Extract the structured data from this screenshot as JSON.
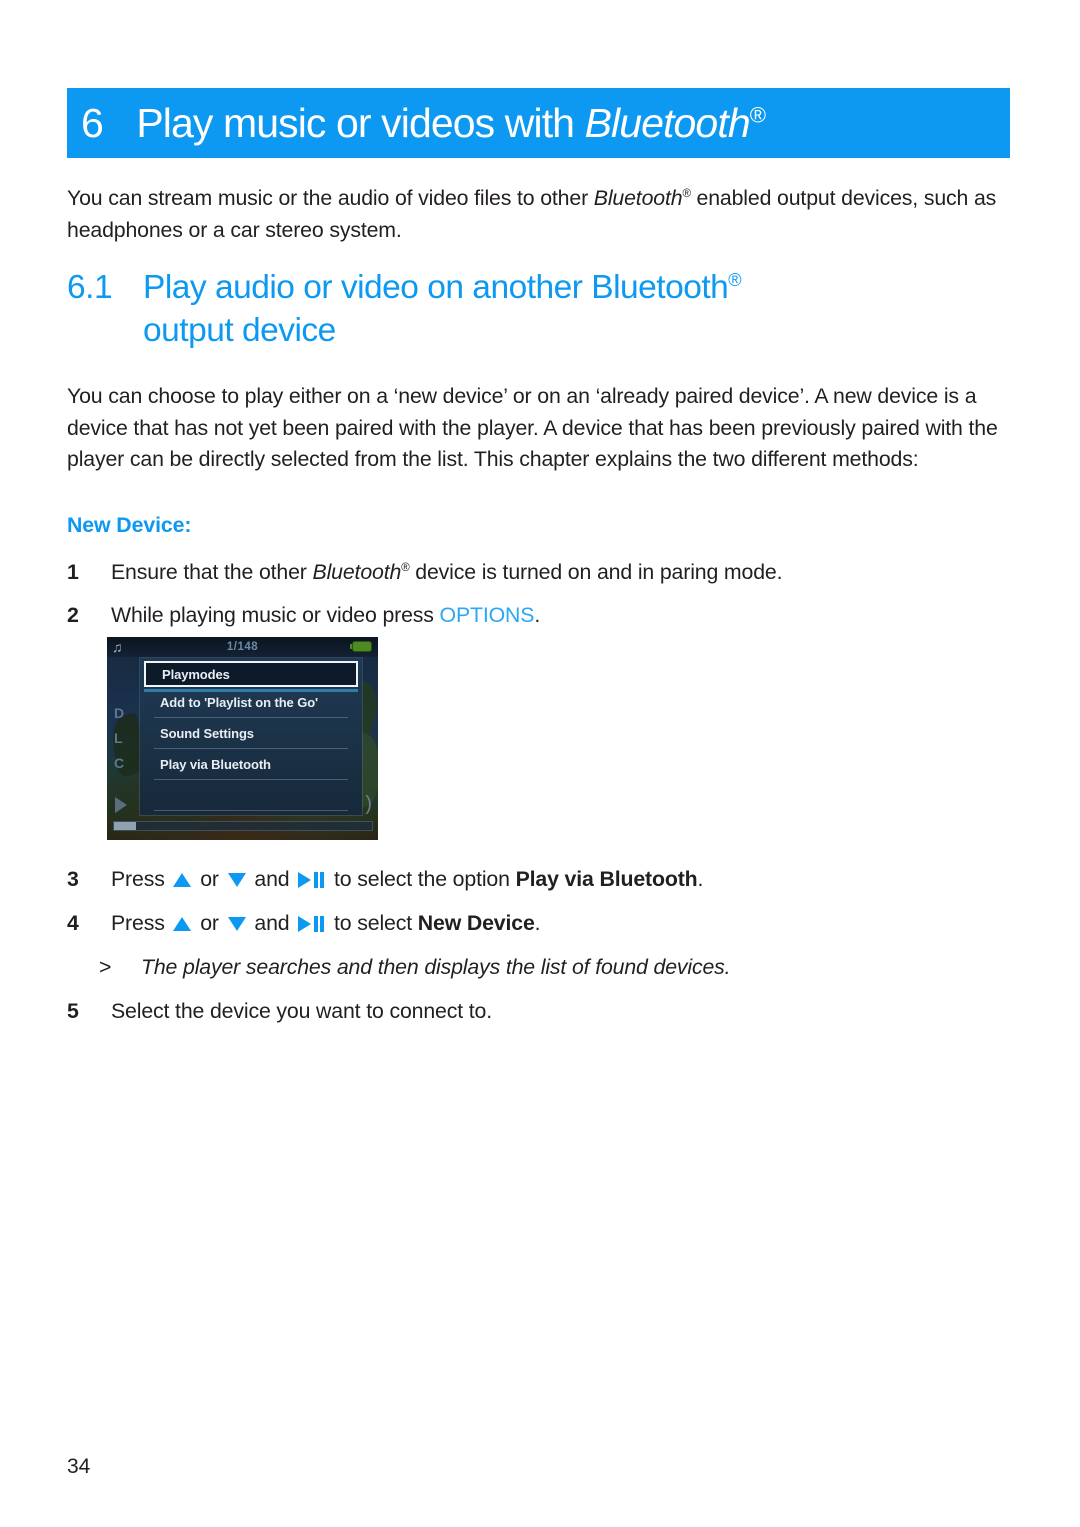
{
  "colors": {
    "brand_blue": "#0d99f2",
    "link_blue": "#2aa7f5",
    "body_text": "#231f20"
  },
  "chapter": {
    "number": "6",
    "title_plain": "Play music or videos with ",
    "title_italic": "Bluetooth",
    "registered_mark": "®"
  },
  "intro": {
    "part1": "You can stream music or the audio of video files to other ",
    "italic": "Bluetooth",
    "sup": "®",
    "part2": " enabled output devices, such as headphones or a car stereo system."
  },
  "section": {
    "number": "6.1",
    "title_part1": "Play audio or video on another Bluetooth",
    "sup": "®",
    "title_part2": "output device"
  },
  "methods_para": "You can choose to play either on a ‘new device’ or on an ‘already paired device’. A new device is a device that has not yet been paired with the player. A device that has been previously paired with the player can be directly selected from the list. This chapter explains the two different methods:",
  "subheading": "New Device:",
  "steps": [
    {
      "num": "1",
      "pre": "Ensure that the other ",
      "italic": "Bluetooth",
      "sup": "®",
      "post": " device is turned on and in paring mode."
    },
    {
      "num": "2",
      "pre": "While playing music or video press ",
      "keyword": "OPTIONS",
      "post": "."
    },
    {
      "num": "3",
      "pre": "Press ",
      "mid1": " or ",
      "mid2": " and ",
      "mid3": " to select the option ",
      "bold": "Play via Bluetooth",
      "post": "."
    },
    {
      "num": "4",
      "pre": "Press ",
      "mid1": " or ",
      "mid2": " and ",
      "mid3": " to select ",
      "bold": "New Device",
      "post": "."
    }
  ],
  "note": {
    "marker": ">",
    "text": "The player searches and then displays the list of found devices."
  },
  "step5": {
    "num": "5",
    "text": "Select the device you want to connect to."
  },
  "device_screenshot": {
    "status_bar": {
      "note_icon": "music-note-icon",
      "track_count": "1/148",
      "battery_icon": "battery-icon"
    },
    "background_letters": [
      "D",
      "L",
      "C"
    ],
    "menu_items": [
      {
        "label": "Playmodes",
        "selected": true
      },
      {
        "label": "Add to 'Playlist on the Go'",
        "selected": false
      },
      {
        "label": "Sound Settings",
        "selected": false
      },
      {
        "label": "Play via Bluetooth",
        "selected": false
      }
    ]
  },
  "page_number": "34"
}
